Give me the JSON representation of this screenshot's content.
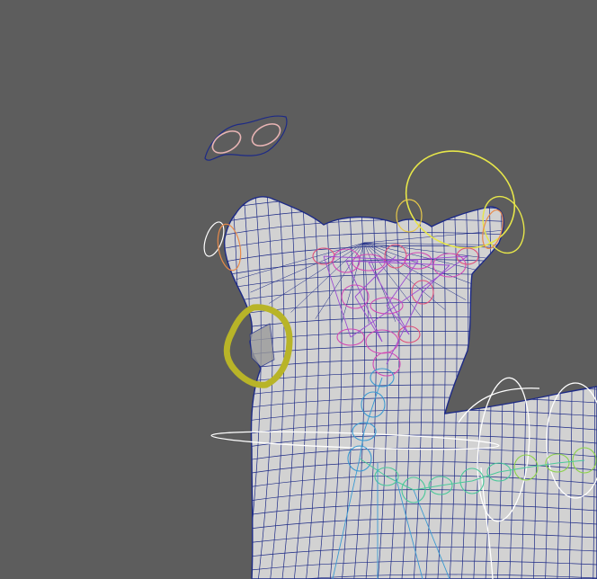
{
  "viewport": {
    "background": "#5d5d5d",
    "mesh_fill": "#d2d2d2",
    "wire_color": "#1d2a86",
    "controls": {
      "nose_ctrl": "#e8b4b4",
      "ear_ctrl": "#e6e64a",
      "jaw_ctrl": "#b8b428",
      "spine_ctrl": "#ffffff",
      "head_joints": "#d24ab4",
      "neck_joints": "#3a9ad2",
      "body_joints": "#4ac89a",
      "tail_joints": "#8cd24a"
    }
  }
}
